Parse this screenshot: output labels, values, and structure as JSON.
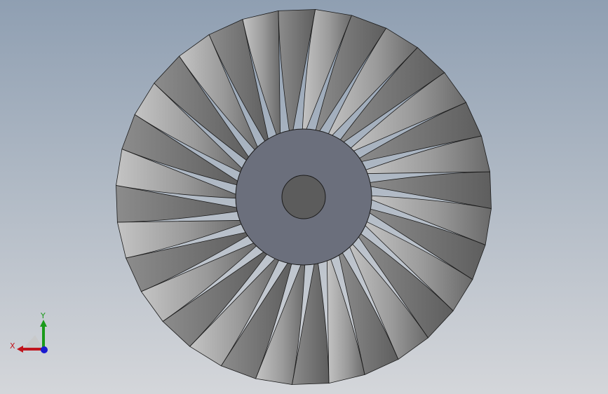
{
  "viewport": {
    "background_top": "#8f9fb2",
    "background_bottom": "#d4d6da"
  },
  "model": {
    "name": "turbine-rotor",
    "blade_count": 32,
    "blade_color_light": "#bdbdbd",
    "blade_color_dark": "#6e6e6e",
    "hub_color": "#6b6f7c",
    "bore_color": "#5c5c5c",
    "edge_color": "#1a1a1a"
  },
  "triad": {
    "x_label": "X",
    "y_label": "Y",
    "x_color": "#c0141c",
    "y_color": "#1a9a1a",
    "z_color": "#1a1ad0"
  }
}
